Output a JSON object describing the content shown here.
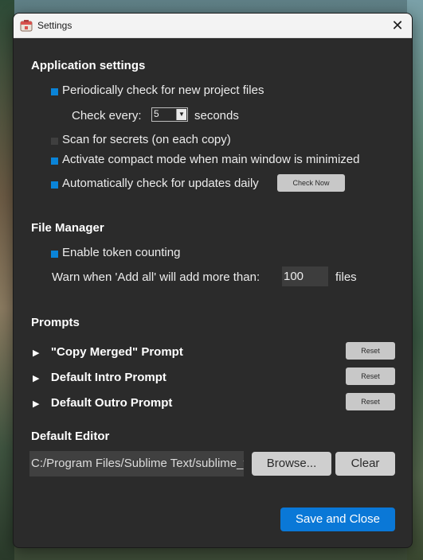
{
  "window": {
    "title": "Settings"
  },
  "application": {
    "heading": "Application settings",
    "periodic_check": {
      "label": "Periodically check for new project files",
      "checked": true
    },
    "check_every": {
      "label": "Check every:",
      "value": "5",
      "unit": "seconds"
    },
    "scan_secrets": {
      "label": "Scan for secrets (on each copy)",
      "checked": false
    },
    "compact_mode": {
      "label": "Activate compact mode when main window is minimized",
      "checked": true
    },
    "auto_update": {
      "label": "Automatically check for updates daily",
      "checked": true,
      "button": "Check Now"
    }
  },
  "file_manager": {
    "heading": "File Manager",
    "token_counting": {
      "label": "Enable token counting",
      "checked": true
    },
    "warn": {
      "label": "Warn when 'Add all' will add more than:",
      "value": "100",
      "unit": "files"
    }
  },
  "prompts": {
    "heading": "Prompts",
    "items": [
      {
        "label": "\"Copy Merged\" Prompt",
        "reset": "Reset"
      },
      {
        "label": "Default Intro Prompt",
        "reset": "Reset"
      },
      {
        "label": "Default Outro Prompt",
        "reset": "Reset"
      }
    ],
    "expand_glyph": "▶"
  },
  "editor": {
    "heading": "Default Editor",
    "path": "C:/Program Files/Sublime Text/sublime_text.exe",
    "browse": "Browse...",
    "clear": "Clear"
  },
  "footer": {
    "save": "Save and Close"
  },
  "colors": {
    "accent": "#0a78d7",
    "checkbox_on": "#0a84d8",
    "background": "#2b2b2b"
  }
}
